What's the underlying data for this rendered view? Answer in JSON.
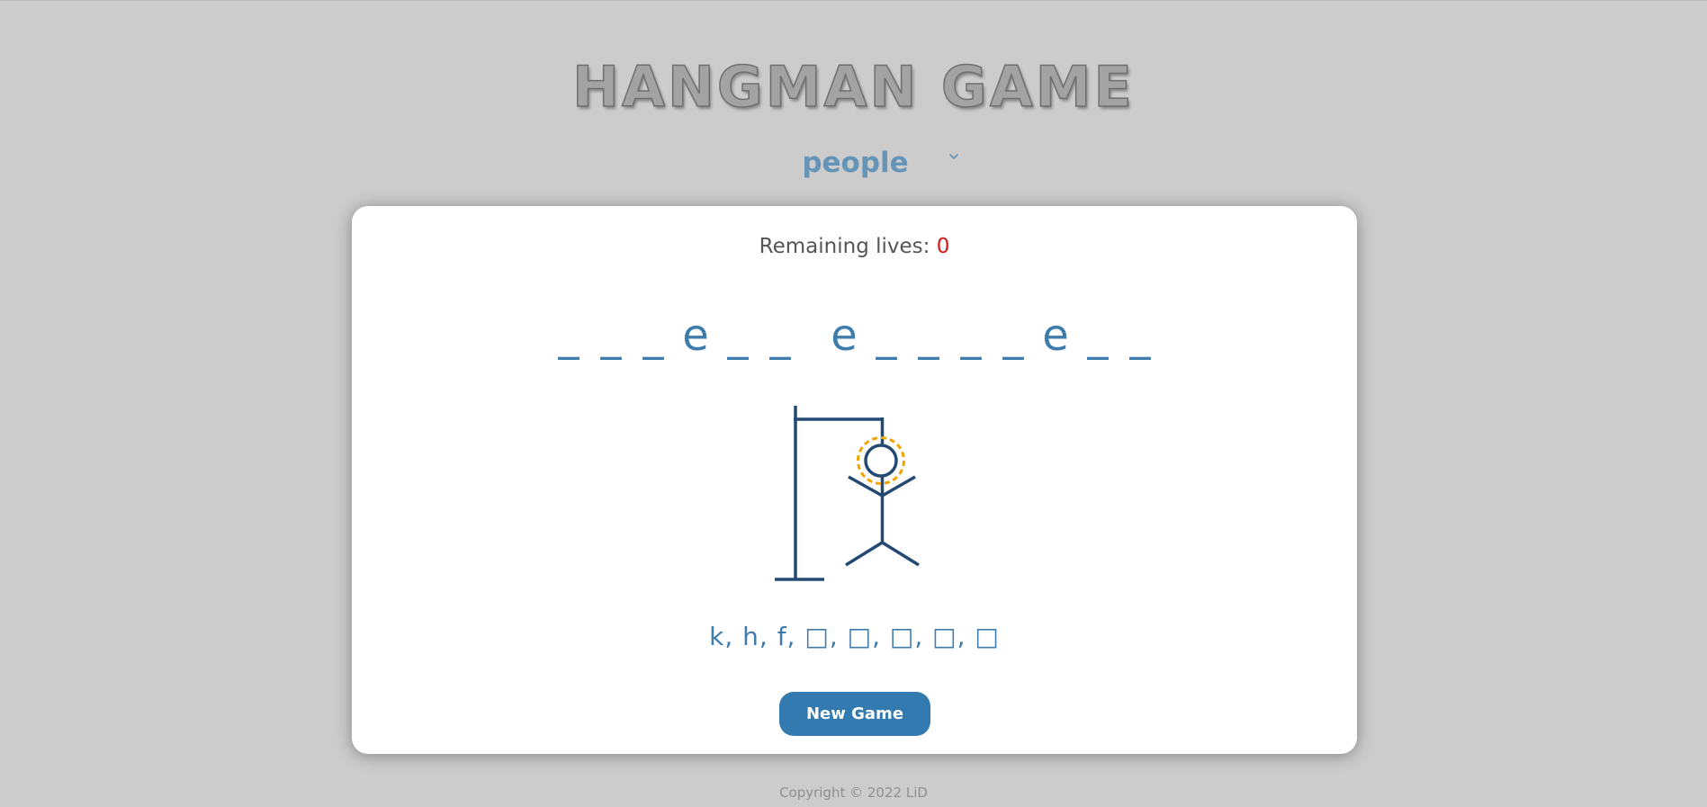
{
  "header": {
    "title": "HANGMAN GAME"
  },
  "category": {
    "selected": "people",
    "icon": "chevron-down-icon"
  },
  "game": {
    "lives_label": "Remaining lives: ",
    "lives_value": "0",
    "word": [
      [
        "_",
        "_",
        "_",
        "e",
        "_",
        "_"
      ],
      [
        "e",
        "_",
        "_",
        "_",
        "_",
        "e",
        "_",
        "_"
      ]
    ],
    "guesses": "k, h, f, □, □, □, □, □",
    "hangman_figure": "hangman-gallows-figure",
    "new_game_label": "New Game"
  },
  "footer": {
    "copyright": "Copyright © 2022 LiD"
  },
  "colors": {
    "background": "#cccccc",
    "card": "#ffffff",
    "accent": "#337ab0",
    "word": "#3e7cad",
    "lives_value": "#d11a1a",
    "category": "#6594b9",
    "figure": "#234a73",
    "halo": "#f0a500"
  }
}
